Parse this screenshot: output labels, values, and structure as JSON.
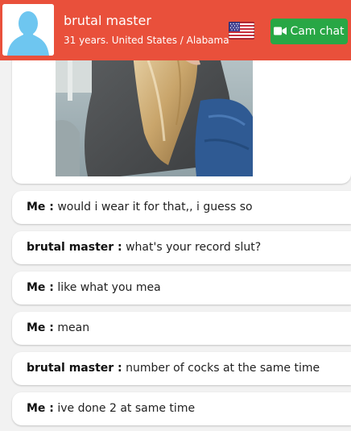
{
  "header": {
    "name": "brutal master",
    "meta": "31 years. United States / Alabama",
    "flag_icon": "us-flag-icon",
    "cam_button_label": "Cam chat",
    "cam_icon": "video-camera-icon",
    "background": "#e9503b",
    "cam_button_color": "#28a745"
  },
  "chat": {
    "messages": [
      {
        "sender": "Me :",
        "text": "would i wear it for that,, i guess so"
      },
      {
        "sender": "brutal master :",
        "text": "what's your record slut?"
      },
      {
        "sender": "Me :",
        "text": "like what you mea"
      },
      {
        "sender": "Me :",
        "text": "mean"
      },
      {
        "sender": "brutal master :",
        "text": "number of cocks at the same time"
      },
      {
        "sender": "Me :",
        "text": "ive done 2 at same time"
      }
    ]
  }
}
